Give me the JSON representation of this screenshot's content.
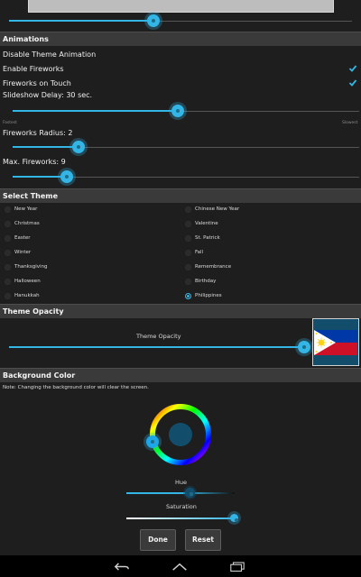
{
  "animations": {
    "header": "Animations",
    "disable_theme_animation": "Disable Theme Animation",
    "enable_fireworks": "Enable Fireworks",
    "enable_fireworks_checked": true,
    "fireworks_on_touch": "Fireworks on Touch",
    "fireworks_on_touch_checked": true,
    "slideshow_delay": "Slideshow Delay: 30 sec.",
    "slideshow_delay_fraction": 0.5,
    "fastest_label": "Fastest",
    "slowest_label": "Slowest",
    "fireworks_radius": "Fireworks Radius: 2",
    "fireworks_radius_fraction": 0.2,
    "max_fireworks": "Max. Fireworks: 9",
    "max_fireworks_fraction": 0.16
  },
  "top_slider_fraction": 0.41,
  "select_theme": {
    "header": "Select Theme",
    "left_column": [
      "New Year",
      "Christmas",
      "Easter",
      "Winter",
      "Thanksgiving",
      "Halloween",
      "Hanukkah"
    ],
    "right_column": [
      "Chinese New Year",
      "Valentine",
      "St. Patrick",
      "Fall",
      "Remembrance",
      "Birthday",
      "Philippines"
    ],
    "selected": "Philippines"
  },
  "theme_opacity": {
    "header": "Theme Opacity",
    "slider_label": "Theme Opacity",
    "value_fraction": 1.0
  },
  "background_color": {
    "header": "Background Color",
    "note": "Note: Changing the background color will clear the screen.",
    "selected_color": "#124e6b",
    "hue_label": "Hue",
    "hue_fraction": 0.55,
    "saturation_label": "Saturation",
    "saturation_fraction": 1.0
  },
  "buttons": {
    "done": "Done",
    "reset": "Reset"
  },
  "colors": {
    "accent": "#33b5e5",
    "header_bg": "#3a3a3a",
    "background": "#1e1e1e",
    "flag_blue": "#0038a8",
    "flag_red": "#ce1126",
    "flag_white": "#ffffff",
    "flag_yellow": "#fcd116"
  },
  "navigation": [
    "back-icon",
    "home-icon",
    "recents-icon"
  ]
}
